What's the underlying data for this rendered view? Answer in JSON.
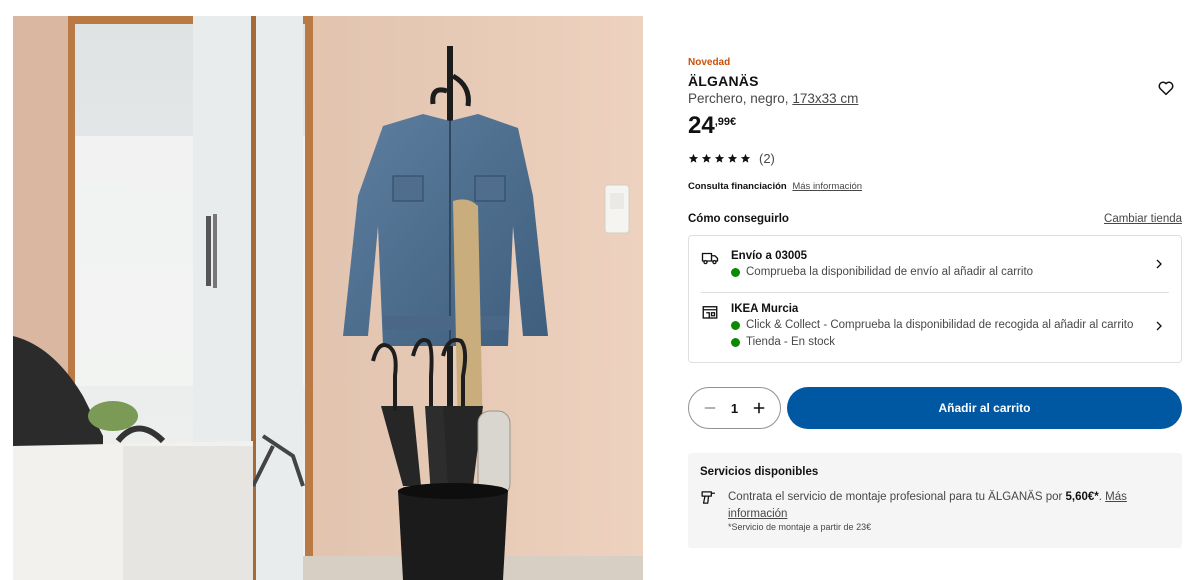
{
  "product": {
    "badge": "Novedad",
    "name": "ÄLGANÄS",
    "description": "Perchero, negro,",
    "measure": "173x33 cm",
    "price_int": "24",
    "price_dec": ",99",
    "currency": "€",
    "rating_count": "(2)",
    "rating_stars": 5
  },
  "finance": {
    "label": "Consulta financiación",
    "link": "Más información"
  },
  "availability": {
    "heading": "Cómo conseguirlo",
    "change_store": "Cambiar tienda",
    "delivery": {
      "title": "Envío a 03005",
      "line": "Comprueba la disponibilidad de envío al añadir al carrito"
    },
    "store": {
      "title": "IKEA Murcia",
      "line1": "Click & Collect - Comprueba la disponibilidad de recogida al añadir al carrito",
      "line2": "Tienda - En stock"
    },
    "status_color": "#0a8a00"
  },
  "cart": {
    "quantity": "1",
    "add_label": "Añadir al carrito",
    "button_color": "#0058a3"
  },
  "services": {
    "heading": "Servicios disponibles",
    "text_pre": "Contrata el servicio de montaje profesional para tu ÄLGANÄS por ",
    "price": "5,60€*",
    "text_post": ". ",
    "more": "Más información",
    "note": "*Servicio de montaje a partir de 23€"
  },
  "icons": {
    "favorite": "heart-outline-icon",
    "delivery": "truck-icon",
    "store": "store-icon",
    "service": "drill-icon",
    "chevron": "chevron-right-icon",
    "minus": "minus-icon",
    "plus": "plus-icon",
    "star": "star-icon"
  }
}
